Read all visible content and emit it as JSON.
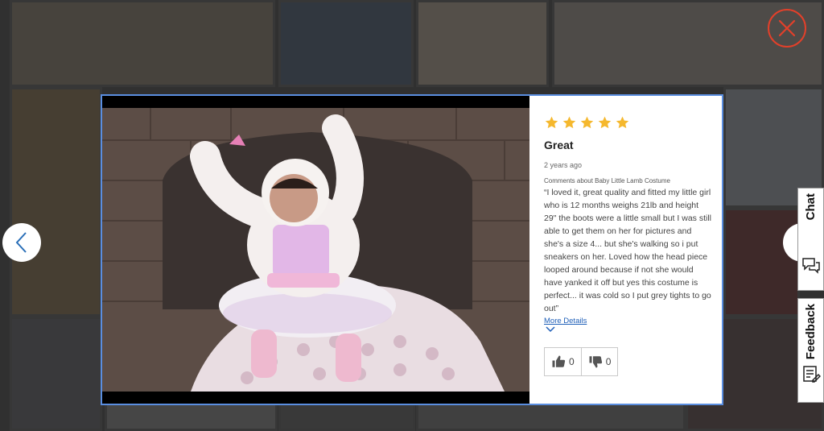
{
  "review": {
    "rating": 5,
    "title": "Great",
    "date": "2 years ago",
    "subject": "Comments about Baby Little Lamb Costume",
    "body": "“I loved it, great quality and fitted my little girl who is 12 months weighs 21lb and height 29\" the boots were a little small but I was still able to get them on her for pictures and she's a size 4... but she's walking so i put sneakers on her. Loved how the head piece looped around because if not she would have yanked it off but yes this costume is perfect... it was cold so I put grey tights to go out”",
    "more_details": "More Details",
    "helpful_count": "0",
    "unhelpful_count": "0"
  },
  "side_tabs": {
    "chat": "Chat",
    "feedback": "Feedback"
  },
  "colors": {
    "star": "#f5b82e",
    "accent_link": "#1f5fb8",
    "close": "#e2402a",
    "modal_border": "#5a8ee0"
  },
  "icons": {
    "close": "close-icon",
    "prev": "chevron-left-icon",
    "next": "chevron-right-icon",
    "thumbs_up": "thumbs-up-icon",
    "thumbs_down": "thumbs-down-icon",
    "chat": "chat-bubbles-icon",
    "feedback": "feedback-form-icon"
  }
}
